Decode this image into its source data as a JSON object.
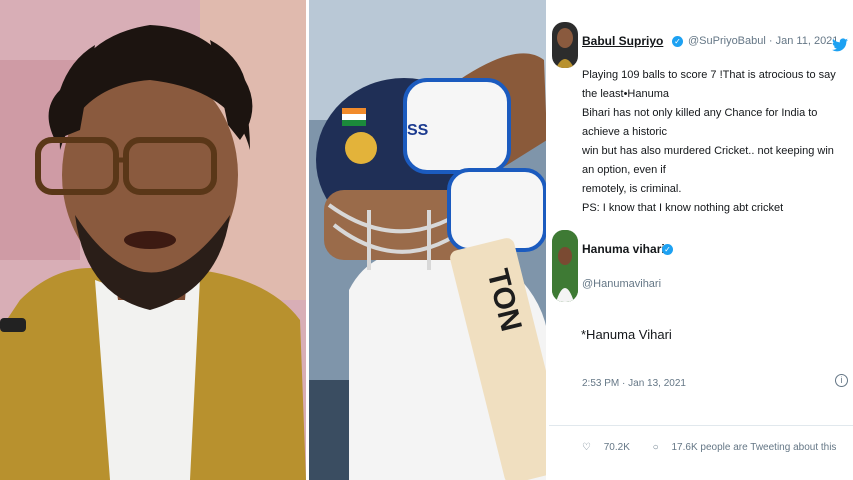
{
  "tweet": {
    "author_name": "Babul Supriyo",
    "author_handle": "@SuPriyoBabul",
    "date": "Jan 11, 2021",
    "line1": "Playing 109 balls to score 7 !That is atrocious to say the least•Hanuma",
    "line2": "Bihari has not only killed any Chance for India to achieve a historic",
    "line3": "win but has also murdered Cricket.. not keeping win an option, even if",
    "line4": "remotely, is criminal.",
    "line5": "PS: I know that I know nothing abt cricket",
    "separator": "·"
  },
  "reply": {
    "author_name": "Hanuma vihari",
    "author_handle": "@Hanumavihari",
    "text": "*Hanuma Vihari",
    "timestamp": "2:53 PM · Jan 13, 2021",
    "likes": "70.2K",
    "tweeting": "17.6K people are Tweeting about this"
  },
  "photo": {
    "bat_text": "TON",
    "helmet_mark": "SS"
  },
  "icons": {
    "twitter": "twitter-bird-icon",
    "verified": "verified-badge-icon",
    "info": "info-icon",
    "like": "heart-icon",
    "comment": "comment-icon"
  },
  "colors": {
    "twitter_blue": "#1da1f2",
    "text_primary": "#14171a",
    "text_secondary": "#657786"
  }
}
